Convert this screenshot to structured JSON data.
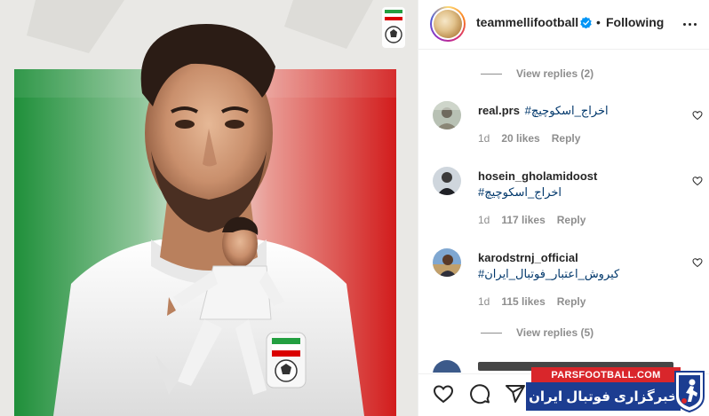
{
  "post": {
    "username": "teammellifootball",
    "separator": "•",
    "follow_status": "Following"
  },
  "comments_top_replies": "View replies (2)",
  "comments": [
    {
      "username": "real.prs",
      "text": "#اخراج_اسکوچیچ",
      "time": "1d",
      "likes": "20 likes",
      "reply": "Reply"
    },
    {
      "username": "hosein_gholamidoost",
      "text": "#اخراج_اسکوچیچ",
      "time": "1d",
      "likes": "117 likes",
      "reply": "Reply"
    },
    {
      "username": "karodstrnj_official",
      "text": "#کیروش_اعتبار_فوتبال_ایران",
      "time": "1d",
      "likes": "115 likes",
      "reply": "Reply"
    }
  ],
  "comments_bottom_replies": "View replies (5)",
  "icons": {
    "verified": "verified-badge-icon",
    "more": "more-options-icon",
    "heart": "heart-icon",
    "comment": "comment-icon",
    "share": "share-icon"
  },
  "watermark": {
    "site": "PARSFOOTBALL.COM",
    "title": "خبرگزاری فوتبال ایران"
  },
  "colors": {
    "link": "#00376b",
    "muted": "#8e8e8e",
    "verified": "#0095f6",
    "flag_green": "#239f40",
    "flag_red": "#da0000",
    "watermark_red": "#d9262b",
    "watermark_blue": "#1c3d91"
  }
}
